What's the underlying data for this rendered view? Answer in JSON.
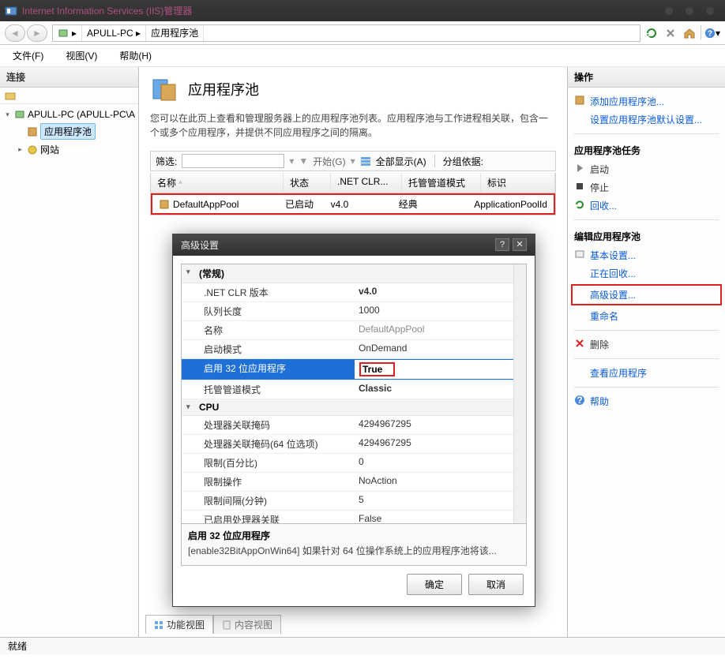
{
  "window_title": "Internet Information Services (IIS)管理器",
  "breadcrumb": {
    "host": "APULL-PC",
    "node": "应用程序池"
  },
  "menu": {
    "file": "文件(F)",
    "view": "视图(V)",
    "help": "帮助(H)"
  },
  "sidebar": {
    "header": "连接",
    "root": "APULL-PC (APULL-PC\\A",
    "items": [
      "应用程序池",
      "网站"
    ]
  },
  "content": {
    "title": "应用程序池",
    "desc": "您可以在此页上查看和管理服务器上的应用程序池列表。应用程序池与工作进程相关联，包含一个或多个应用程序，并提供不同应用程序之间的隔离。",
    "filter_label": "筛选:",
    "go_label": "开始(G)",
    "showall_label": "全部显示(A)",
    "groupby_label": "分组依据:",
    "columns": {
      "name": "名称",
      "state": "状态",
      "clr": ".NET CLR...",
      "pipe": "托管管道模式",
      "id": "标识"
    },
    "row": {
      "name": "DefaultAppPool",
      "state": "已启动",
      "clr": "v4.0",
      "pipe": "经典",
      "id": "ApplicationPoolId"
    },
    "tab_features": "功能视图",
    "tab_content": "内容视图"
  },
  "actions": {
    "header": "操作",
    "add": "添加应用程序池...",
    "set_defaults": "设置应用程序池默认设置...",
    "tasks_header": "应用程序池任务",
    "start": "启动",
    "stop": "停止",
    "recycle": "回收...",
    "edit_header": "编辑应用程序池",
    "basic": "基本设置...",
    "recycling": "正在回收...",
    "advanced": "高级设置...",
    "rename": "重命名",
    "delete": "删除",
    "view_apps": "查看应用程序",
    "help": "帮助"
  },
  "dialog": {
    "title": "高级设置",
    "cat_general": "(常规)",
    "rows_general": [
      {
        "k": ".NET CLR 版本",
        "v": "v4.0",
        "bold": true
      },
      {
        "k": "队列长度",
        "v": "1000"
      },
      {
        "k": "名称",
        "v": "DefaultAppPool",
        "dis": true
      },
      {
        "k": "启动模式",
        "v": "OnDemand"
      },
      {
        "k": "启用 32 位应用程序",
        "v": "True",
        "sel": true
      },
      {
        "k": "托管管道模式",
        "v": "Classic",
        "bold": true
      }
    ],
    "cat_cpu": "CPU",
    "rows_cpu": [
      {
        "k": "处理器关联掩码",
        "v": "4294967295"
      },
      {
        "k": "处理器关联掩码(64 位选项)",
        "v": "4294967295"
      },
      {
        "k": "限制(百分比)",
        "v": "0"
      },
      {
        "k": "限制操作",
        "v": "NoAction"
      },
      {
        "k": "限制间隔(分钟)",
        "v": "5"
      },
      {
        "k": "已启用处理器关联",
        "v": "False"
      }
    ],
    "desc_title": "启用 32 位应用程序",
    "desc_body": "[enable32BitAppOnWin64] 如果针对 64 位操作系统上的应用程序池将该...",
    "ok": "确定",
    "cancel": "取消"
  },
  "status": "就绪"
}
